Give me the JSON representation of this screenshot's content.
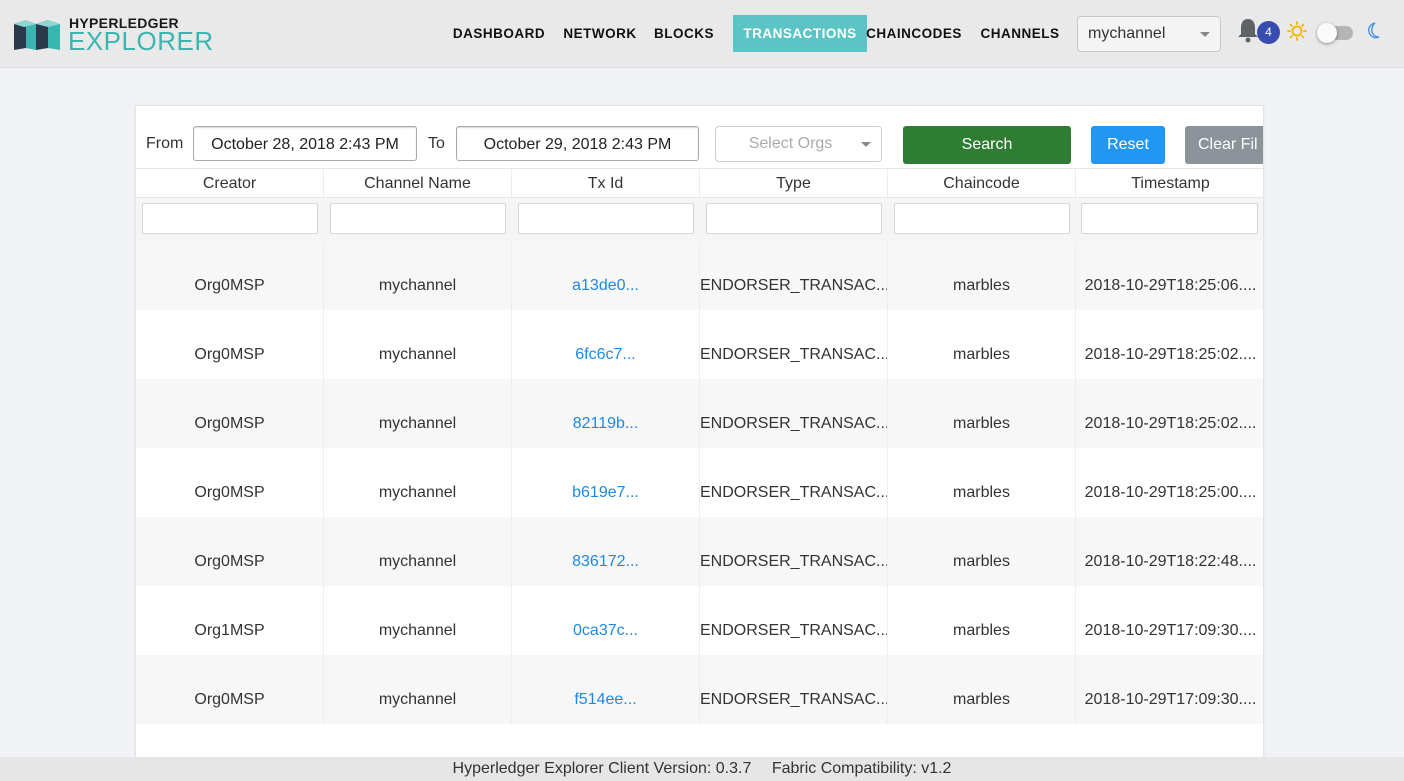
{
  "logo": {
    "line1": "HYPERLEDGER",
    "line2": "EXPLORER",
    "icon": "hyperledger-cubes-logo"
  },
  "nav": {
    "items": [
      {
        "label": "DASHBOARD",
        "active": false
      },
      {
        "label": "NETWORK",
        "active": false
      },
      {
        "label": "BLOCKS",
        "active": false
      },
      {
        "label": "TRANSACTIONS",
        "active": true
      },
      {
        "label": "CHAINCODES",
        "active": false
      },
      {
        "label": "CHANNELS",
        "active": false
      }
    ],
    "channel_selected": "mychannel",
    "notification_count": "4",
    "icons": [
      "bell-icon",
      "sun-icon",
      "theme-toggle",
      "moon-icon"
    ]
  },
  "filters": {
    "from_label": "From",
    "from_value": "October 28, 2018 2:43 PM",
    "to_label": "To",
    "to_value": "October 29, 2018 2:43 PM",
    "orgs_placeholder": "Select Orgs",
    "search_label": "Search",
    "reset_label": "Reset",
    "clear_label": "Clear Fil"
  },
  "table": {
    "columns": [
      "Creator",
      "Channel Name",
      "Tx Id",
      "Type",
      "Chaincode",
      "Timestamp"
    ],
    "rows": [
      [
        "Org0MSP",
        "mychannel",
        "a13de0...",
        "ENDORSER_TRANSAC...",
        "marbles",
        "2018-10-29T18:25:06...."
      ],
      [
        "Org0MSP",
        "mychannel",
        "6fc6c7...",
        "ENDORSER_TRANSAC...",
        "marbles",
        "2018-10-29T18:25:02...."
      ],
      [
        "Org0MSP",
        "mychannel",
        "82119b...",
        "ENDORSER_TRANSAC...",
        "marbles",
        "2018-10-29T18:25:02...."
      ],
      [
        "Org0MSP",
        "mychannel",
        "b619e7...",
        "ENDORSER_TRANSAC...",
        "marbles",
        "2018-10-29T18:25:00...."
      ],
      [
        "Org0MSP",
        "mychannel",
        "836172...",
        "ENDORSER_TRANSAC...",
        "marbles",
        "2018-10-29T18:22:48...."
      ],
      [
        "Org1MSP",
        "mychannel",
        "0ca37c...",
        "ENDORSER_TRANSAC...",
        "marbles",
        "2018-10-29T17:09:30...."
      ],
      [
        "Org0MSP",
        "mychannel",
        "f514ee...",
        "ENDORSER_TRANSAC...",
        "marbles",
        "2018-10-29T17:09:30...."
      ]
    ]
  },
  "footer": {
    "version": "Hyperledger Explorer Client Version: 0.3.7",
    "compat": "Fabric Compatibility: v1.2"
  },
  "colors": {
    "accent_teal": "#5bc4c4",
    "search_green": "#2e7d32",
    "reset_blue": "#2196f3",
    "clear_gray": "#8c939b",
    "link_blue": "#1e88e5",
    "badge_indigo": "#3a4bb0"
  }
}
